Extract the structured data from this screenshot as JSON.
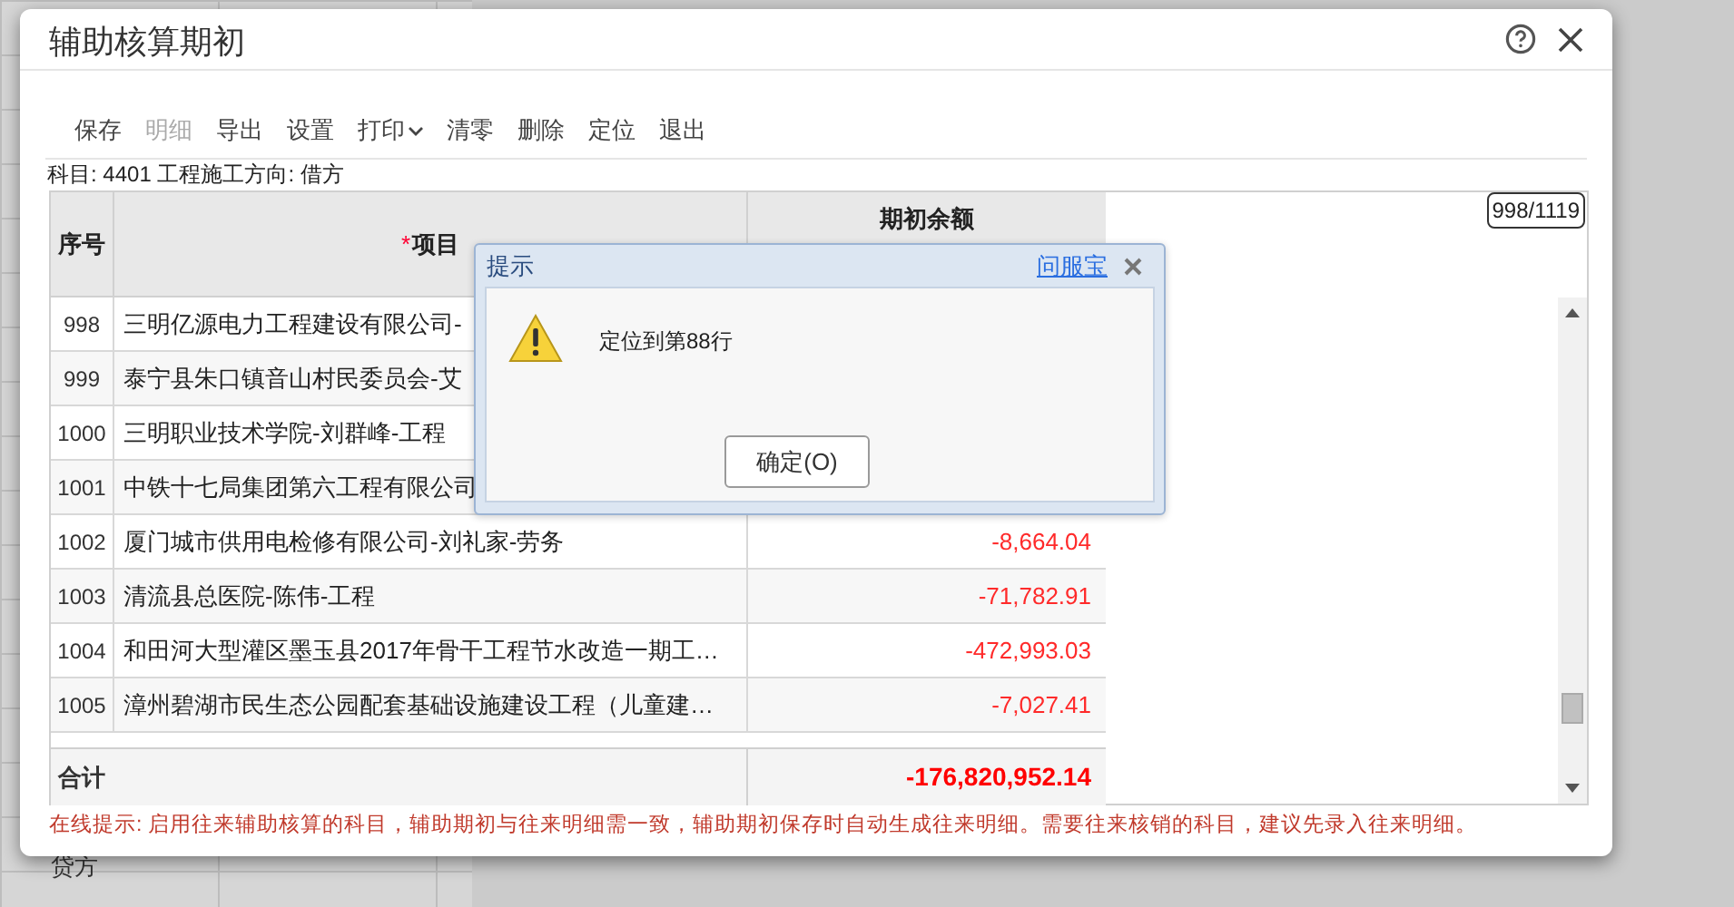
{
  "background_sheet": {
    "cell_text": "贷方"
  },
  "window": {
    "title": "辅助核算期初"
  },
  "toolbar": [
    {
      "label": "保存",
      "disabled": false,
      "kind": "button"
    },
    {
      "label": "明细",
      "disabled": true,
      "kind": "button"
    },
    {
      "label": "导出",
      "disabled": false,
      "kind": "button"
    },
    {
      "label": "设置",
      "disabled": false,
      "kind": "button"
    },
    {
      "label": "打印",
      "disabled": false,
      "kind": "dropdown"
    },
    {
      "label": "清零",
      "disabled": false,
      "kind": "button"
    },
    {
      "label": "删除",
      "disabled": false,
      "kind": "button"
    },
    {
      "label": "定位",
      "disabled": false,
      "kind": "button"
    },
    {
      "label": "退出",
      "disabled": false,
      "kind": "button"
    }
  ],
  "subject_line": "科目: 4401 工程施工方向: 借方",
  "table": {
    "columns": [
      "序号",
      "项目",
      "期初余额"
    ],
    "required_mark": "*",
    "counter": "998/1119",
    "rows": [
      {
        "no": "998",
        "item": "三明亿源电力工程建设有限公司-",
        "amount": ""
      },
      {
        "no": "999",
        "item": "泰宁县朱口镇音山村民委员会-艾",
        "amount": ""
      },
      {
        "no": "1000",
        "item": "三明职业技术学院-刘群峰-工程",
        "amount": ""
      },
      {
        "no": "1001",
        "item": "中铁十七局集团第六工程有限公司",
        "amount": ""
      },
      {
        "no": "1002",
        "item": "厦门城市供用电检修有限公司-刘礼家-劳务",
        "amount": "-8,664.04"
      },
      {
        "no": "1003",
        "item": "清流县总医院-陈伟-工程",
        "amount": "-71,782.91"
      },
      {
        "no": "1004",
        "item": "和田河大型灌区墨玉县2017年骨干工程节水改造一期工…",
        "amount": "-472,993.03"
      },
      {
        "no": "1005",
        "item": "漳州碧湖市民生态公园配套基础设施建设工程（儿童建…",
        "amount": "-7,027.41"
      }
    ],
    "total": {
      "label": "合计",
      "amount": "-176,820,952.14"
    }
  },
  "online_tip": "在线提示: 启用往来辅助核算的科目，辅助期初与往来明细需一致，辅助期初保存时自动生成往来明细。需要往来核销的科目，建议先录入往来明细。",
  "message_box": {
    "title": "提示",
    "link": "问服宝",
    "message": "定位到第88行",
    "button": "确定(O)"
  }
}
